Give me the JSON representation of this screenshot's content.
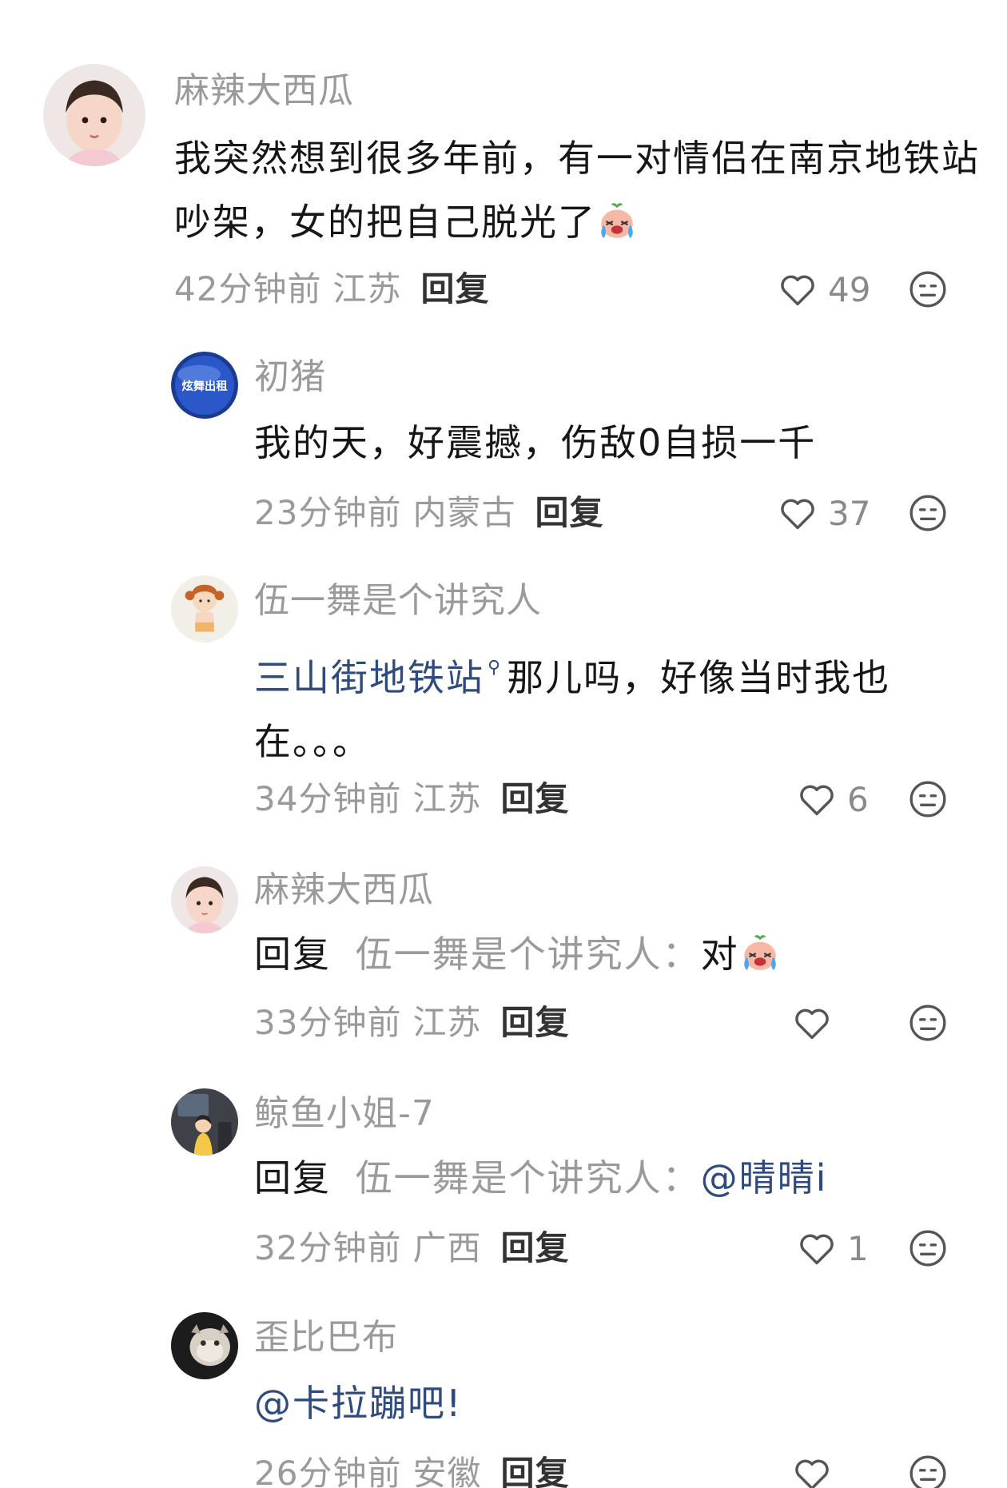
{
  "comments": [
    {
      "username": "麻辣大西瓜",
      "text": "我突然想到很多年前，有一对情侣在南京地铁站吵架，女的把自己脱光了",
      "time": "42分钟前",
      "location": "江苏",
      "reply_label": "回复",
      "likes": "49"
    },
    {
      "username": "初猪",
      "avatar_text": "炫舞出租",
      "text": "我的天，好震撼，伤敌0自损一千",
      "time": "23分钟前",
      "location": "内蒙古",
      "reply_label": "回复",
      "likes": "37"
    },
    {
      "username": "伍一舞是个讲究人",
      "text_link": "三山街地铁站",
      "text_rest_line1": "那儿吗，好像当时我也",
      "text_rest_line2": "在。。。",
      "time": "34分钟前",
      "location": "江苏",
      "reply_label": "回复",
      "likes": "6"
    },
    {
      "username": "麻辣大西瓜",
      "reply_prefix": "回复",
      "reply_target": "伍一舞是个讲究人：",
      "text": "对",
      "time": "33分钟前",
      "location": "江苏",
      "reply_label": "回复",
      "likes": ""
    },
    {
      "username": "鲸鱼小姐-7",
      "reply_prefix": "回复",
      "reply_target": "伍一舞是个讲究人：",
      "mention": "@晴晴i",
      "time": "32分钟前",
      "location": "广西",
      "reply_label": "回复",
      "likes": "1"
    },
    {
      "username": "歪比巴布",
      "mention": "@卡拉蹦吧!",
      "time": "26分钟前",
      "location": "安徽",
      "reply_label": "回复",
      "likes": ""
    }
  ],
  "icons": {
    "like": "heart-outline-icon",
    "dislike": "meh-face-icon",
    "emoji": "crying-laughing-emoji-icon",
    "search": "search-icon"
  },
  "colors": {
    "username": "#9a9a9a",
    "text": "#161616",
    "link": "#2f4a7e"
  }
}
